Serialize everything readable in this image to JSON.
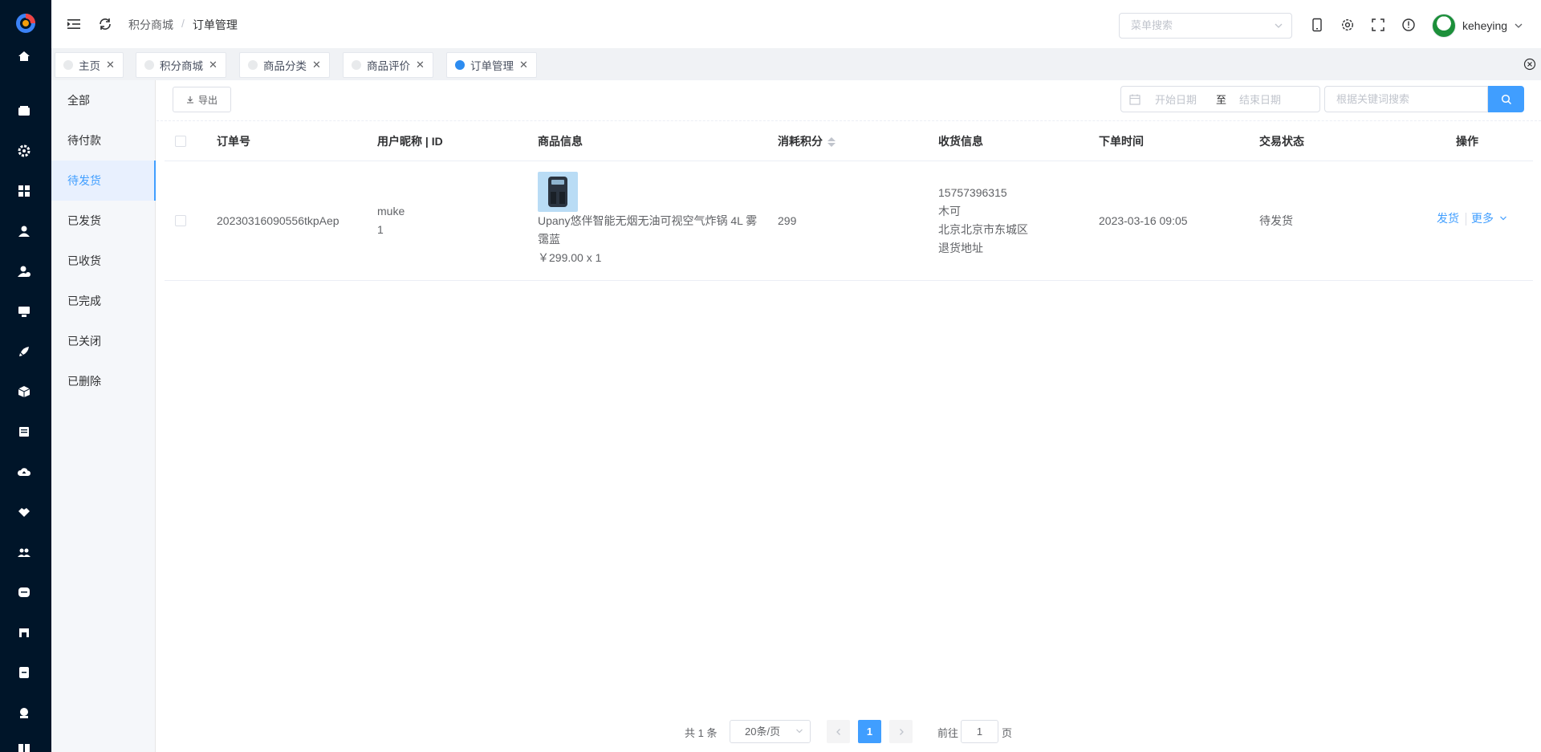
{
  "header": {
    "breadcrumb": [
      "积分商城",
      "订单管理"
    ],
    "breadcrumb_sep": "/",
    "menu_search_placeholder": "菜单搜索",
    "username": "keheying"
  },
  "tabs": [
    {
      "label": "主页",
      "active": false
    },
    {
      "label": "积分商城",
      "active": false
    },
    {
      "label": "商品分类",
      "active": false
    },
    {
      "label": "商品评价",
      "active": false
    },
    {
      "label": "订单管理",
      "active": true
    }
  ],
  "status_menu": {
    "items": [
      "全部",
      "待付款",
      "待发货",
      "已发货",
      "已收货",
      "已完成",
      "已关闭",
      "已删除"
    ],
    "active": "待发货"
  },
  "toolbar": {
    "export_label": "导出",
    "start_date_placeholder": "开始日期",
    "range_separator": "至",
    "end_date_placeholder": "结束日期",
    "keyword_placeholder": "根据关键词搜索"
  },
  "table": {
    "columns": [
      "订单号",
      "用户昵称 | ID",
      "商品信息",
      "消耗积分",
      "收货信息",
      "下单时间",
      "交易状态",
      "操作"
    ],
    "rows": [
      {
        "order_no": "20230316090556tkpAep",
        "user_nick": "muke",
        "user_id": "1",
        "product_name_line1": "Upany悠伴智能无烟无油可视空气炸锅 4L 雾",
        "product_name_line2": "霭蓝",
        "product_price": "￥299.00 x 1",
        "points": "299",
        "ship_phone": "15757396315",
        "ship_name": "木可",
        "ship_region": "北京北京市东城区",
        "ship_address": "退货地址",
        "order_time": "2023-03-16 09:05",
        "status": "待发货",
        "action_ship": "发货",
        "action_more": "更多"
      }
    ]
  },
  "pagination": {
    "total_text": "共 1 条",
    "page_size": "20条/页",
    "current_page": "1",
    "goto_label": "前往",
    "goto_value": "1",
    "page_suffix": "页"
  },
  "colors": {
    "primary": "#409eff",
    "sidebar_bg": "#001529",
    "active_tab_dot": "#2d8cf0"
  },
  "icons": {
    "rail": [
      "logo-icon",
      "home-icon",
      "wallet-icon",
      "settings-icon",
      "dashboard-icon",
      "user-icon",
      "user-check-icon",
      "monitor-icon",
      "rocket-icon",
      "package-icon",
      "document-icon",
      "cloud-upload-icon",
      "handshake-icon",
      "team-icon",
      "chat-icon",
      "shop-icon",
      "note-icon",
      "support-icon",
      "book-icon"
    ]
  }
}
